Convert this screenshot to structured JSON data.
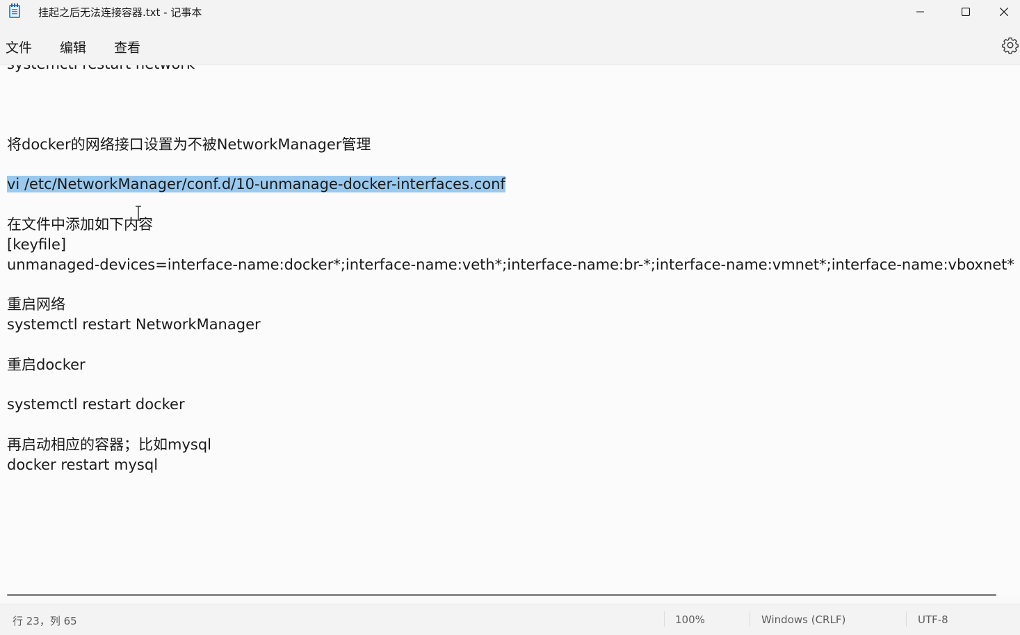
{
  "window": {
    "title": "挂起之后无法连接容器.txt - 记事本",
    "icon": "notepad-icon"
  },
  "menu": {
    "file": "文件",
    "edit": "编辑",
    "view": "查看",
    "settings_icon": "gear-icon"
  },
  "editor": {
    "lines": [
      "systemctl restart network",
      "将docker的网络接口设置为不被NetworkManager管理",
      "vi /etc/NetworkManager/conf.d/10-unmanage-docker-interfaces.conf",
      "在文件中添加如下内容",
      "[keyfile]",
      "unmanaged-devices=interface-name:docker*;interface-name:veth*;interface-name:br-*;interface-name:vmnet*;interface-name:vboxnet*",
      "重启网络",
      "systemctl restart NetworkManager",
      "重启docker",
      "systemctl restart docker",
      "再启动相应的容器；比如mysql",
      "docker restart mysql"
    ],
    "selection_color": "#99c9ef"
  },
  "status": {
    "position": "行 23，列 65",
    "zoom": "100%",
    "line_ending": "Windows (CRLF)",
    "encoding": "UTF-8"
  }
}
